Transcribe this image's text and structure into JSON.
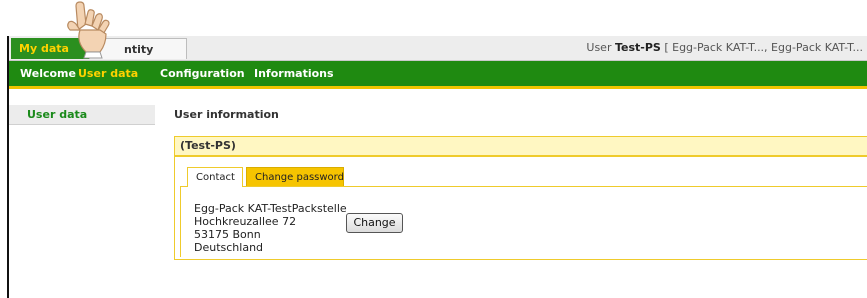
{
  "header": {
    "tabs": [
      {
        "label": "My data",
        "active": true
      },
      {
        "label": "Entity Flow",
        "visible_label": "ntity Flow",
        "active": false
      }
    ],
    "user_status": {
      "prefix": "User",
      "username": "Test-PS",
      "suffix": "[ Egg-Pack KAT-T..., Egg-Pack KAT-T..."
    }
  },
  "nav": {
    "items": [
      {
        "label": "Welcome",
        "active": false
      },
      {
        "label": "User data",
        "active": true
      },
      {
        "label": "Configuration",
        "active": false
      },
      {
        "label": "Informations",
        "active": false
      }
    ]
  },
  "sidebar": {
    "items": [
      {
        "label": "User data"
      }
    ]
  },
  "main": {
    "title": "User information",
    "panel_title": "(Test-PS)",
    "tabs": [
      {
        "label": "Contact",
        "active": true
      },
      {
        "label": "Change password",
        "active": false
      }
    ],
    "address": [
      "Egg-Pack KAT-TestPackstelle",
      "Hochkreuzallee 72",
      "53175 Bonn",
      "Deutschland"
    ],
    "change_button": "Change"
  },
  "colors": {
    "nav_green": "#1f8a11",
    "active_yellow": "#ffd200",
    "panel_border": "#efcb2c",
    "sidebar_text": "#1a8a1a"
  },
  "icons": {
    "cursor": "pointing-hand-icon"
  }
}
